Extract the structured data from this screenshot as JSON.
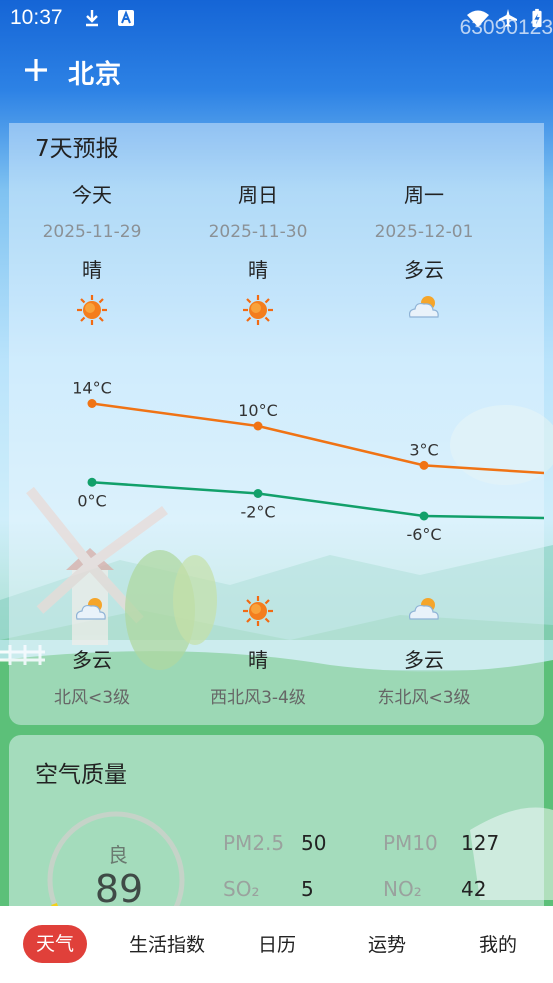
{
  "status_bar": {
    "time": "10:37",
    "code": "63090123"
  },
  "app_bar": {
    "city": "北京"
  },
  "forecast": {
    "title": "7天预报",
    "days": [
      {
        "name": "今天",
        "date": "2025-11-29",
        "day_cond": "晴",
        "day_icon": "sun-icon",
        "high": "14°C",
        "low": "0°C",
        "night_icon": "partly-cloudy-icon",
        "night_cond": "多云",
        "wind": "北风<3级"
      },
      {
        "name": "周日",
        "date": "2025-11-30",
        "day_cond": "晴",
        "day_icon": "sun-icon",
        "high": "10°C",
        "low": "-2°C",
        "night_icon": "sun-icon",
        "night_cond": "晴",
        "wind": "西北风3-4级"
      },
      {
        "name": "周一",
        "date": "2025-12-01",
        "day_cond": "多云",
        "day_icon": "partly-cloudy-icon",
        "high": "3°C",
        "low": "-6°C",
        "night_icon": "partly-cloudy-icon",
        "night_cond": "多云",
        "wind": "东北风<3级"
      }
    ],
    "colors": {
      "high_line": "#f07314",
      "low_line": "#12a06a"
    }
  },
  "air_quality": {
    "title": "空气质量",
    "level": "良",
    "aqi": "89",
    "pollutants": [
      {
        "name": "PM2.5",
        "value": "50"
      },
      {
        "name": "PM10",
        "value": "127"
      },
      {
        "name": "SO₂",
        "value": "5"
      },
      {
        "name": "NO₂",
        "value": "42"
      }
    ]
  },
  "nav": {
    "tabs": [
      "天气",
      "生活指数",
      "日历",
      "运势",
      "我的"
    ],
    "active": "天气",
    "accent": "#e0403a"
  }
}
